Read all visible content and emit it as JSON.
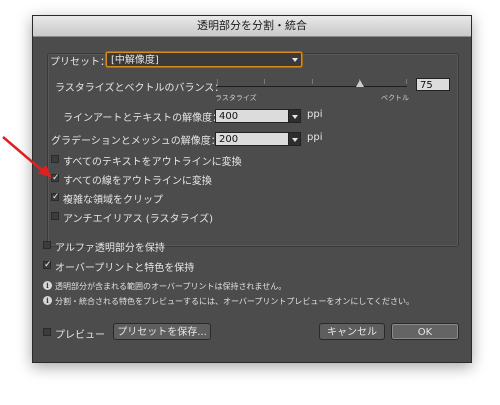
{
  "dialog": {
    "title": "透明部分を分割・統合"
  },
  "preset": {
    "label": "プリセット：",
    "value": "[中解像度]"
  },
  "balance": {
    "label": "ラスタライズとベクトルのバランス：",
    "value": "75",
    "fraction": 0.75,
    "left_caption": "ラスタライズ",
    "right_caption": "ベクトル"
  },
  "line_text_resolution": {
    "label": "ラインアートとテキストの解像度：",
    "value": "400",
    "unit": "ppi"
  },
  "gradient_mesh_resolution": {
    "label": "グラデーションとメッシュの解像度：",
    "value": "200",
    "unit": "ppi"
  },
  "options": [
    {
      "label": "すべてのテキストをアウトラインに変換",
      "checked": false
    },
    {
      "label": "すべての線をアウトラインに変換",
      "checked": true
    },
    {
      "label": "複雑な領域をクリップ",
      "checked": true
    },
    {
      "label": "アンチエイリアス (ラスタライズ)",
      "checked": false
    }
  ],
  "alpha_option": {
    "label": "アルファ透明部分を保持",
    "checked": false
  },
  "overprint_option": {
    "label": "オーバープリントと特色を保持",
    "checked": true
  },
  "notes": [
    "透明部分が含まれる範囲のオーバープリントは保持されません。",
    "分割・統合される特色をプレビューするには、オーバープリントプレビューをオンにしてください。"
  ],
  "preview": {
    "label": "プレビュー",
    "checked": false
  },
  "buttons": {
    "save_preset": "プリセットを保存...",
    "cancel": "キャンセル",
    "ok": "OK"
  },
  "colors": {
    "dialog_bg": "#4c4c4c",
    "focus_ring": "#d98c1a",
    "annotation_arrow": "#e02020"
  }
}
